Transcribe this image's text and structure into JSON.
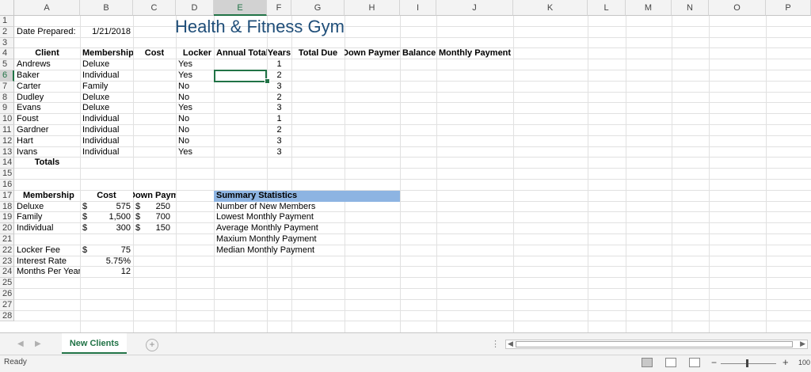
{
  "columns": [
    "A",
    "B",
    "C",
    "D",
    "E",
    "F",
    "G",
    "H",
    "I",
    "J",
    "K",
    "L",
    "M",
    "N",
    "O",
    "P"
  ],
  "rows": [
    "1",
    "2",
    "3",
    "4",
    "5",
    "6",
    "7",
    "8",
    "9",
    "10",
    "11",
    "12",
    "13",
    "14",
    "15",
    "16",
    "17",
    "18",
    "19",
    "20",
    "21",
    "22",
    "23",
    "24",
    "25",
    "26",
    "27",
    "28"
  ],
  "title": "Health & Fitness Gym",
  "date_label": "Date Prepared:",
  "date_value": "1/21/2018",
  "clients_header": [
    "Client",
    "Membership",
    "Cost",
    "Locker",
    "Annual Total",
    "Years",
    "Total Due",
    "Down Payment",
    "Balance",
    "Monthly Payment"
  ],
  "clients": [
    {
      "client": "Andrews",
      "membership": "Deluxe",
      "locker": "Yes",
      "years": "1"
    },
    {
      "client": "Baker",
      "membership": "Individual",
      "locker": "Yes",
      "years": "2"
    },
    {
      "client": "Carter",
      "membership": "Family",
      "locker": "No",
      "years": "3"
    },
    {
      "client": "Dudley",
      "membership": "Deluxe",
      "locker": "No",
      "years": "2"
    },
    {
      "client": "Evans",
      "membership": "Deluxe",
      "locker": "Yes",
      "years": "3"
    },
    {
      "client": "Foust",
      "membership": "Individual",
      "locker": "No",
      "years": "1"
    },
    {
      "client": "Gardner",
      "membership": "Individual",
      "locker": "No",
      "years": "2"
    },
    {
      "client": "Hart",
      "membership": "Individual",
      "locker": "No",
      "years": "3"
    },
    {
      "client": "Ivans",
      "membership": "Individual",
      "locker": "Yes",
      "years": "3"
    }
  ],
  "totals_label": "Totals",
  "membership_header": [
    "Membership",
    "Cost",
    "Down Payment"
  ],
  "membership_table": [
    {
      "name": "Deluxe",
      "cost": "575",
      "down": "250"
    },
    {
      "name": "Family",
      "cost": "1,500",
      "down": "700"
    },
    {
      "name": "Individual",
      "cost": "300",
      "down": "150"
    }
  ],
  "currency_symbol": "$",
  "locker_fee_label": "Locker Fee",
  "locker_fee_value": "75",
  "interest_label": "Interest Rate",
  "interest_value": "5.75%",
  "months_label": "Months Per Year",
  "months_value": "12",
  "summary_header": "Summary Statistics",
  "summary_items": [
    "Number of New Members",
    "Lowest Monthly Payment",
    "Average Monthly Payment",
    "Maxium Monthly Payment",
    "Median Monthly Payment"
  ],
  "sheet_tab": "New Clients",
  "add_sheet_symbol": "+",
  "status": "Ready",
  "zoom_level": "100",
  "colors": {
    "accent": "#217346",
    "title": "#1f4e79",
    "summary_fill": "#8db4e2"
  }
}
